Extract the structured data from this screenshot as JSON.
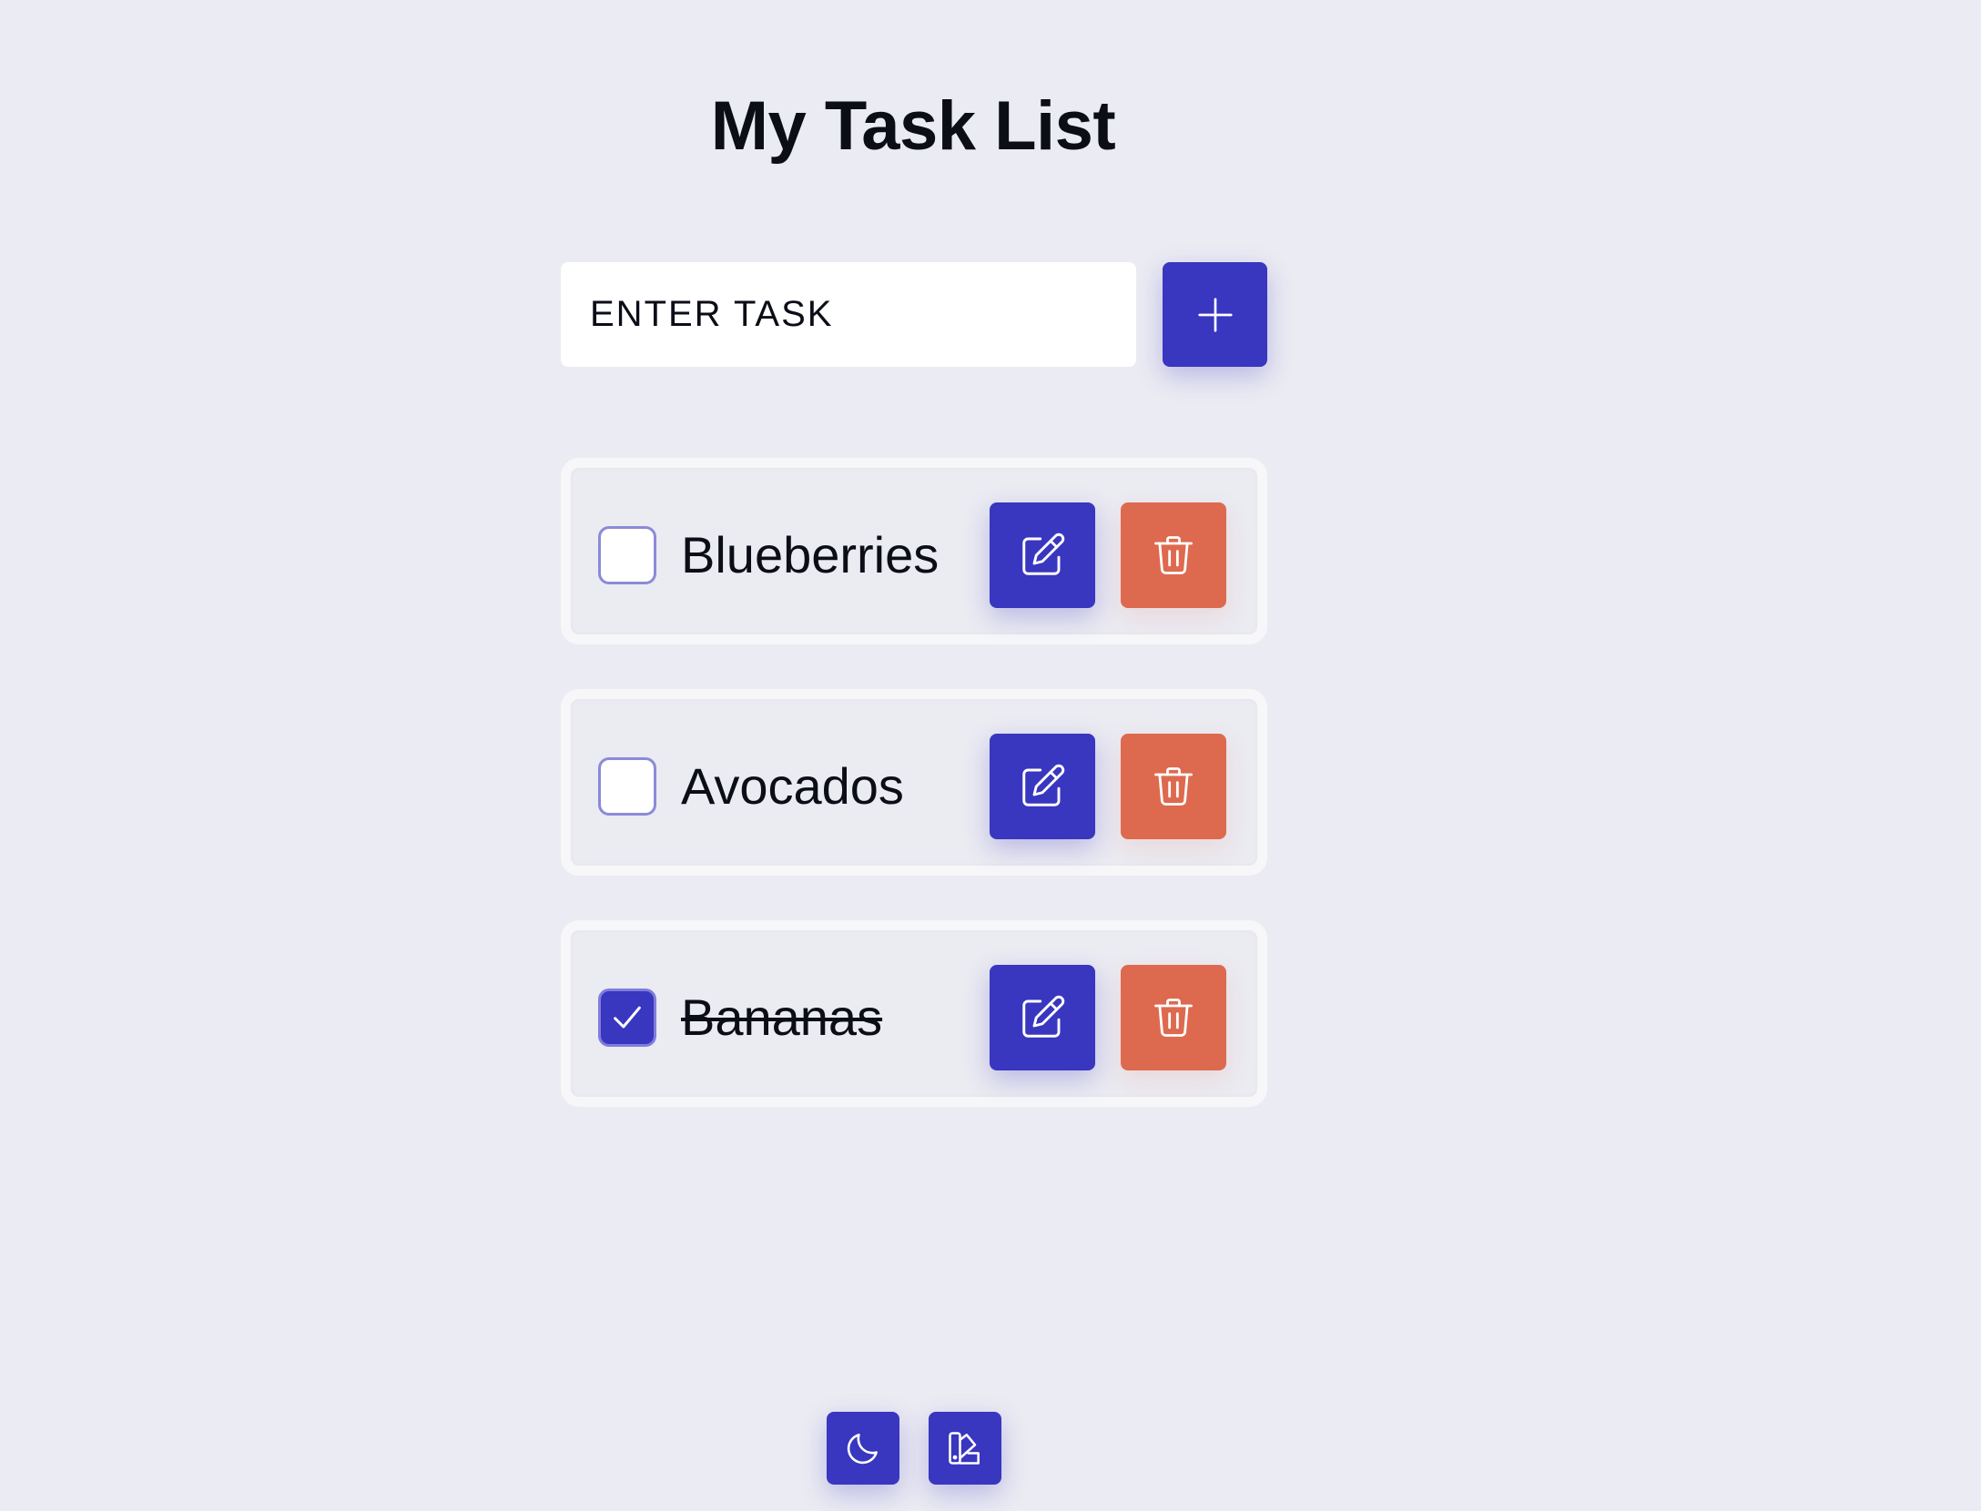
{
  "header": {
    "title": "My Task List"
  },
  "new_task": {
    "placeholder": "ENTER TASK",
    "value": "",
    "add_icon": "plus-icon"
  },
  "tasks": [
    {
      "label": "Blueberries",
      "completed": false
    },
    {
      "label": "Avocados",
      "completed": false
    },
    {
      "label": "Bananas",
      "completed": true
    }
  ],
  "task_actions": {
    "edit_icon": "edit-icon",
    "delete_icon": "trash-icon"
  },
  "footer": {
    "theme_toggle_icon": "moon-icon",
    "palette_icon": "palette-icon"
  },
  "colors": {
    "background": "#ebebf3",
    "primary": "#3936c0",
    "danger": "#dd6a4f",
    "text": "#0b0d17",
    "checkbox_border": "#8c8ad8"
  }
}
